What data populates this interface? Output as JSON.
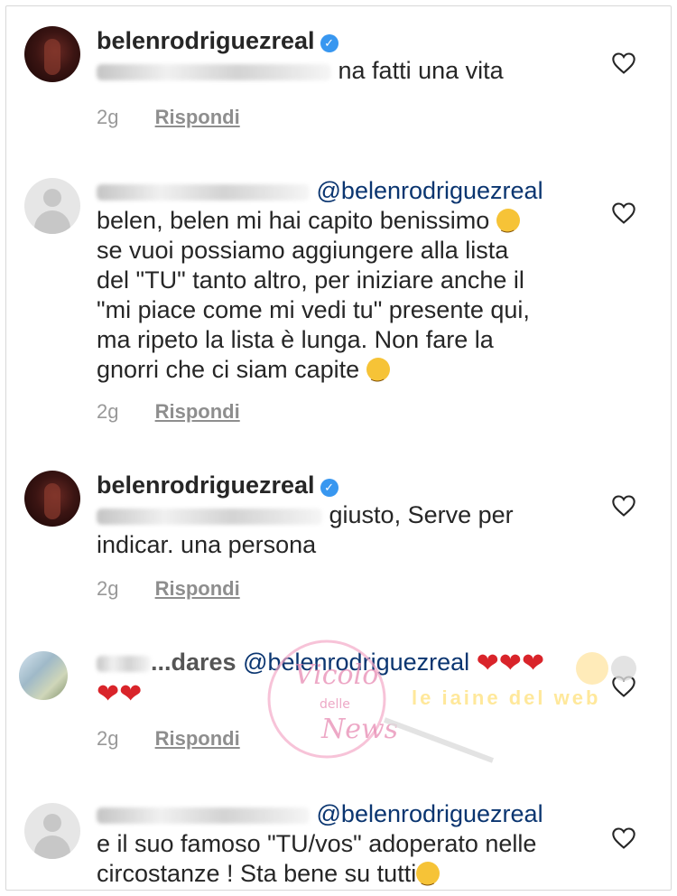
{
  "comments": [
    {
      "username": "belenrodriguezreal",
      "verified": true,
      "text_tail": "na fatti una vita",
      "time": "2g",
      "reply_label": "Rispondi"
    },
    {
      "mention": "@belenrodriguezreal",
      "lines": [
        "belen, belen mi hai capito benissimo",
        "se vuoi possiamo aggiungere alla lista",
        "del \"TU\" tanto altro, per iniziare anche il",
        "\"mi piace come mi vedi tu\" presente qui,",
        "ma ripeto la lista è lunga. Non fare la",
        "gnorri che ci siam capite"
      ],
      "time": "2g",
      "reply_label": "Rispondi"
    },
    {
      "username": "belenrodriguezreal",
      "verified": true,
      "line1_tail": "giusto, Serve per",
      "line2": "indicar. una persona",
      "time": "2g",
      "reply_label": "Rispondi"
    },
    {
      "username_partial": "...dares",
      "mention": "@belenrodriguezreal",
      "time": "2g",
      "reply_label": "Rispondi"
    },
    {
      "mention": "@belenrodriguezreal",
      "lines": [
        "e il suo famoso \"TU/vos\" adoperato nelle",
        "circostanze ! Sta bene su tutti"
      ]
    }
  ],
  "watermark": {
    "logo_line1": "Vicolo",
    "logo_line2": "delle",
    "logo_line3": "News",
    "banner": "le iaine del web"
  },
  "colors": {
    "mention": "#0a3570",
    "verified": "#3897f0",
    "meta": "#999999",
    "heart_emoji": "#d9242a"
  }
}
